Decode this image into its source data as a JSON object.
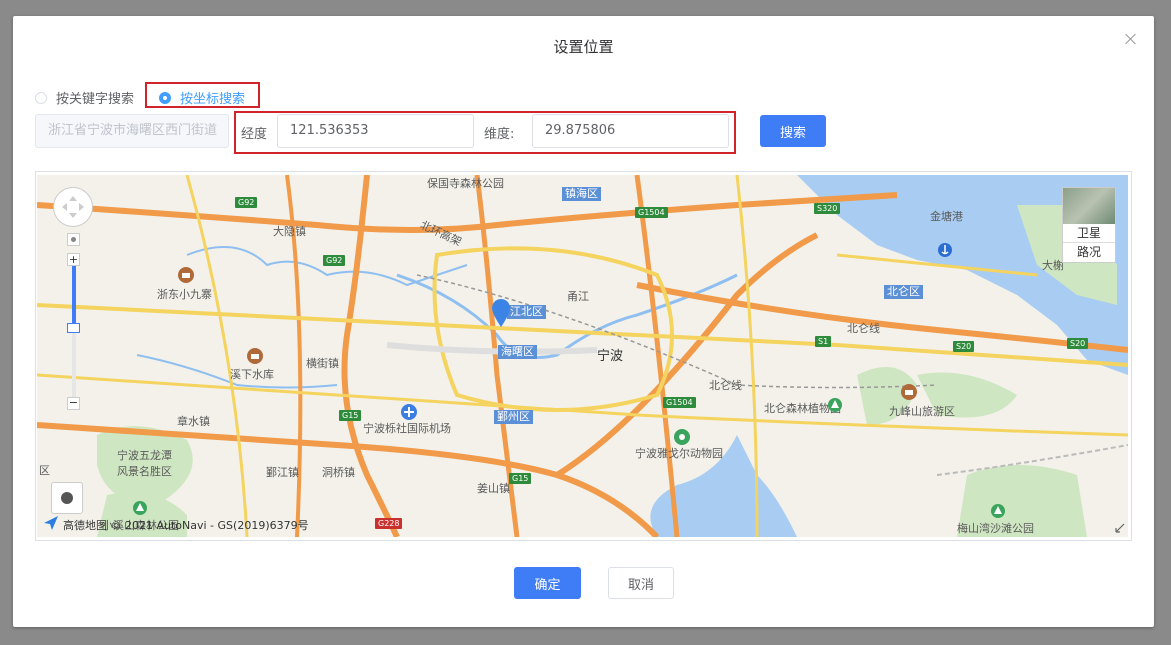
{
  "dialog": {
    "title": "设置位置"
  },
  "search_mode": {
    "keyword_label": "按关键字搜索",
    "coord_label": "按坐标搜索",
    "selected": "coord"
  },
  "address": {
    "value": "浙江省宁波市海曙区西门街道"
  },
  "longitude": {
    "label": "经度",
    "value": "121.536353"
  },
  "latitude": {
    "label": "维度:",
    "value": "29.875806"
  },
  "search_button": "搜索",
  "map": {
    "labels": {
      "guoqing": "保国寺森林公园",
      "zhenhai": "镇海区",
      "beilun_gs": "北环高架",
      "dayinzhen": "大隐镇",
      "zhedong": "浙东小九寨",
      "xixia": "溪下水库",
      "hengjie": "横街镇",
      "zhangshui": "章水镇",
      "wulong": "宁波五龙潭\n风景名胜区",
      "yinjiang": "鄞江镇",
      "dongqiao": "洞桥镇",
      "jiangbei": "江北区",
      "haishu": "海曙区",
      "ningbo": "宁波",
      "yinzhou": "鄞州区",
      "airport": "宁波栎社国际机场",
      "jiangshan": "姜山镇",
      "beilun": "北仑区",
      "beilun_line": "北仑线",
      "beilunline2": "北仑线",
      "forest": "北仑森林植物园",
      "jiufeng": "九峰山旅游区",
      "zoo": "宁波雅戈尔动物园",
      "jintang": "金塘港",
      "meishan": "梅山湾沙滩公园",
      "dayang": "大榭",
      "xiaojing": "小溪山森林公园",
      "yongjiang": "甬江",
      "qu": "区"
    },
    "shields": [
      "G92",
      "G92",
      "G1504",
      "S320",
      "G15",
      "G1504",
      "S1",
      "S20",
      "S20",
      "G15",
      "G228"
    ],
    "layer_satellite": "卫星",
    "layer_traffic": "路况",
    "copyright": "高德地图 © 2021 AutoNavi - GS(2019)6379号"
  },
  "footer": {
    "ok": "确定",
    "cancel": "取消"
  },
  "colors": {
    "primary": "#3f7df7",
    "highlight": "#d1232a"
  }
}
